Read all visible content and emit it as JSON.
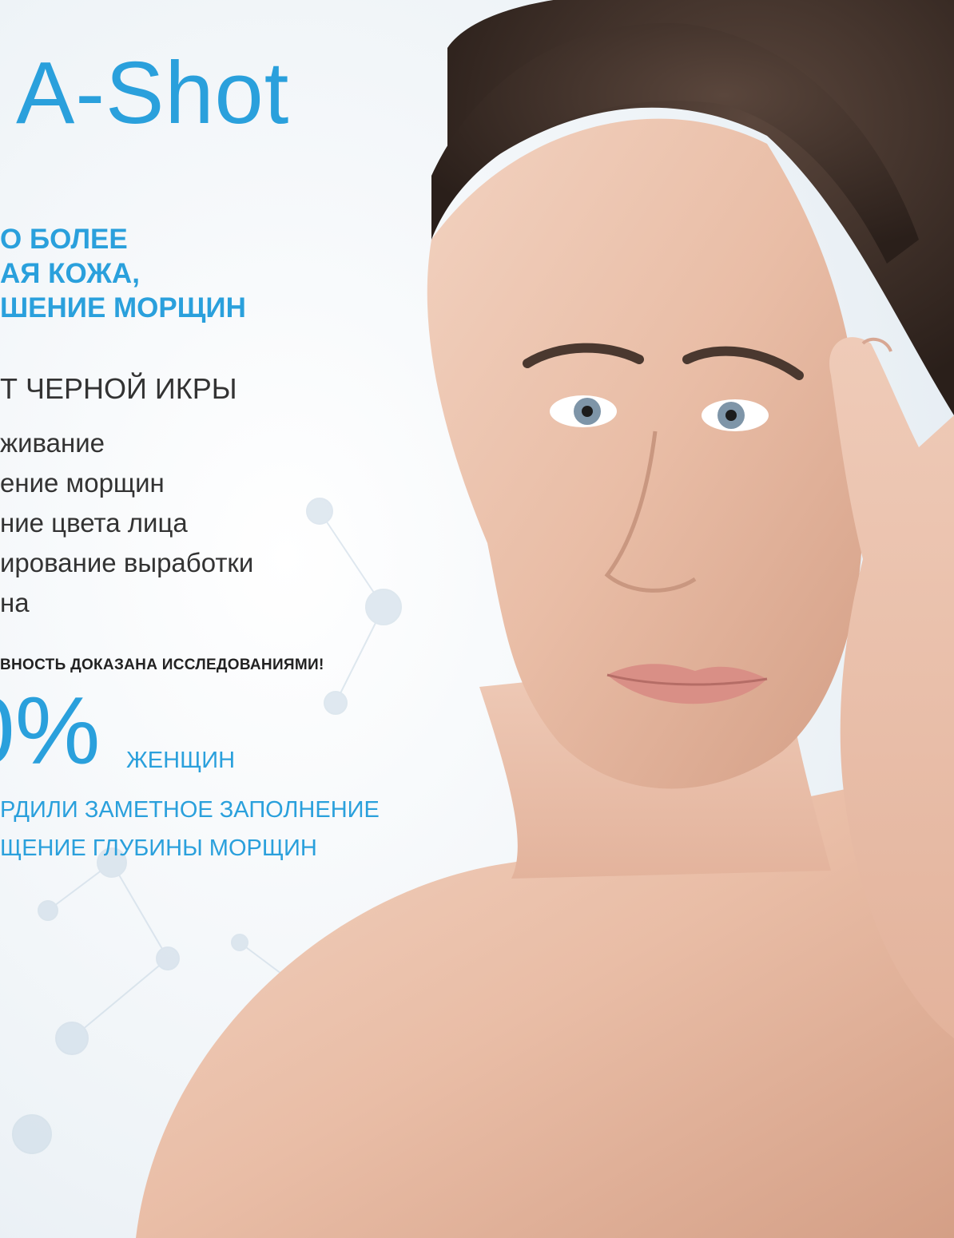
{
  "brand": {
    "title": "A-Shot"
  },
  "headline": [
    "О БОЛЕЕ",
    "АЯ КОЖА,",
    "ШЕНИЕ МОРЩИН"
  ],
  "subheading": "Т ЧЕРНОЙ ИКРЫ",
  "benefits": [
    "живание",
    "ение морщин",
    "ние цвета лица",
    "ирование выработки",
    "на"
  ],
  "efficacy_note": "ВНОСТЬ ДОКАЗАНА ИССЛЕДОВАНИЯМИ!",
  "stat": {
    "number": "0%",
    "word": "ЖЕНЩИН"
  },
  "result": [
    "РДИЛИ ЗАМЕТНОЕ ЗАПОЛНЕНИЕ",
    "ЩЕНИЕ ГЛУБИНЫ МОРЩИН"
  ],
  "colors": {
    "accent": "#2aa0dc",
    "text": "#333333",
    "background": "#eef3f7"
  },
  "photo": {
    "subject": "woman-portrait-touching-temple"
  }
}
